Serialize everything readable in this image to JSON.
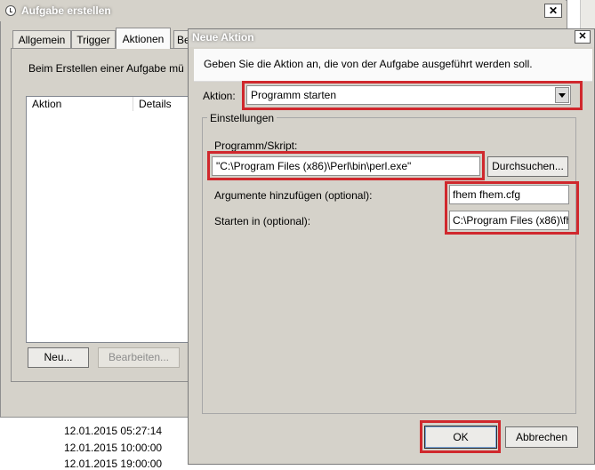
{
  "background_window": {
    "title": "Aufgabe erstellen",
    "tabs": [
      {
        "label": "Allgemein"
      },
      {
        "label": "Trigger"
      },
      {
        "label": "Aktionen"
      },
      {
        "label": "Be"
      }
    ],
    "description": "Beim Erstellen einer Aufgabe mü",
    "columns": [
      "Aktion",
      "Details"
    ],
    "new_button": "Neu...",
    "edit_button": "Bearbeiten...",
    "timestamps": [
      "12.01.2015 05:27:14",
      "12.01.2015 10:00:00",
      "12.01.2015 19:00:00"
    ]
  },
  "dialog": {
    "title": "Neue Aktion",
    "instruction": "Geben Sie die Aktion an, die von der Aufgabe ausgeführt werden soll.",
    "aktion_label": "Aktion:",
    "aktion_value": "Programm starten",
    "settings_label": "Einstellungen",
    "program_label": "Programm/Skript:",
    "program_value": "\"C:\\Program Files (x86)\\Perl\\bin\\perl.exe\"",
    "browse_button": "Durchsuchen...",
    "arguments_label": "Argumente hinzufügen (optional):",
    "arguments_value": "fhem fhem.cfg",
    "start_in_label": "Starten in (optional):",
    "start_in_value": "C:\\Program Files (x86)\\fh",
    "ok_button": "OK",
    "cancel_button": "Abbrechen"
  },
  "colors": {
    "window_bg": "#d5d2ca",
    "highlight": "#d0282d"
  }
}
